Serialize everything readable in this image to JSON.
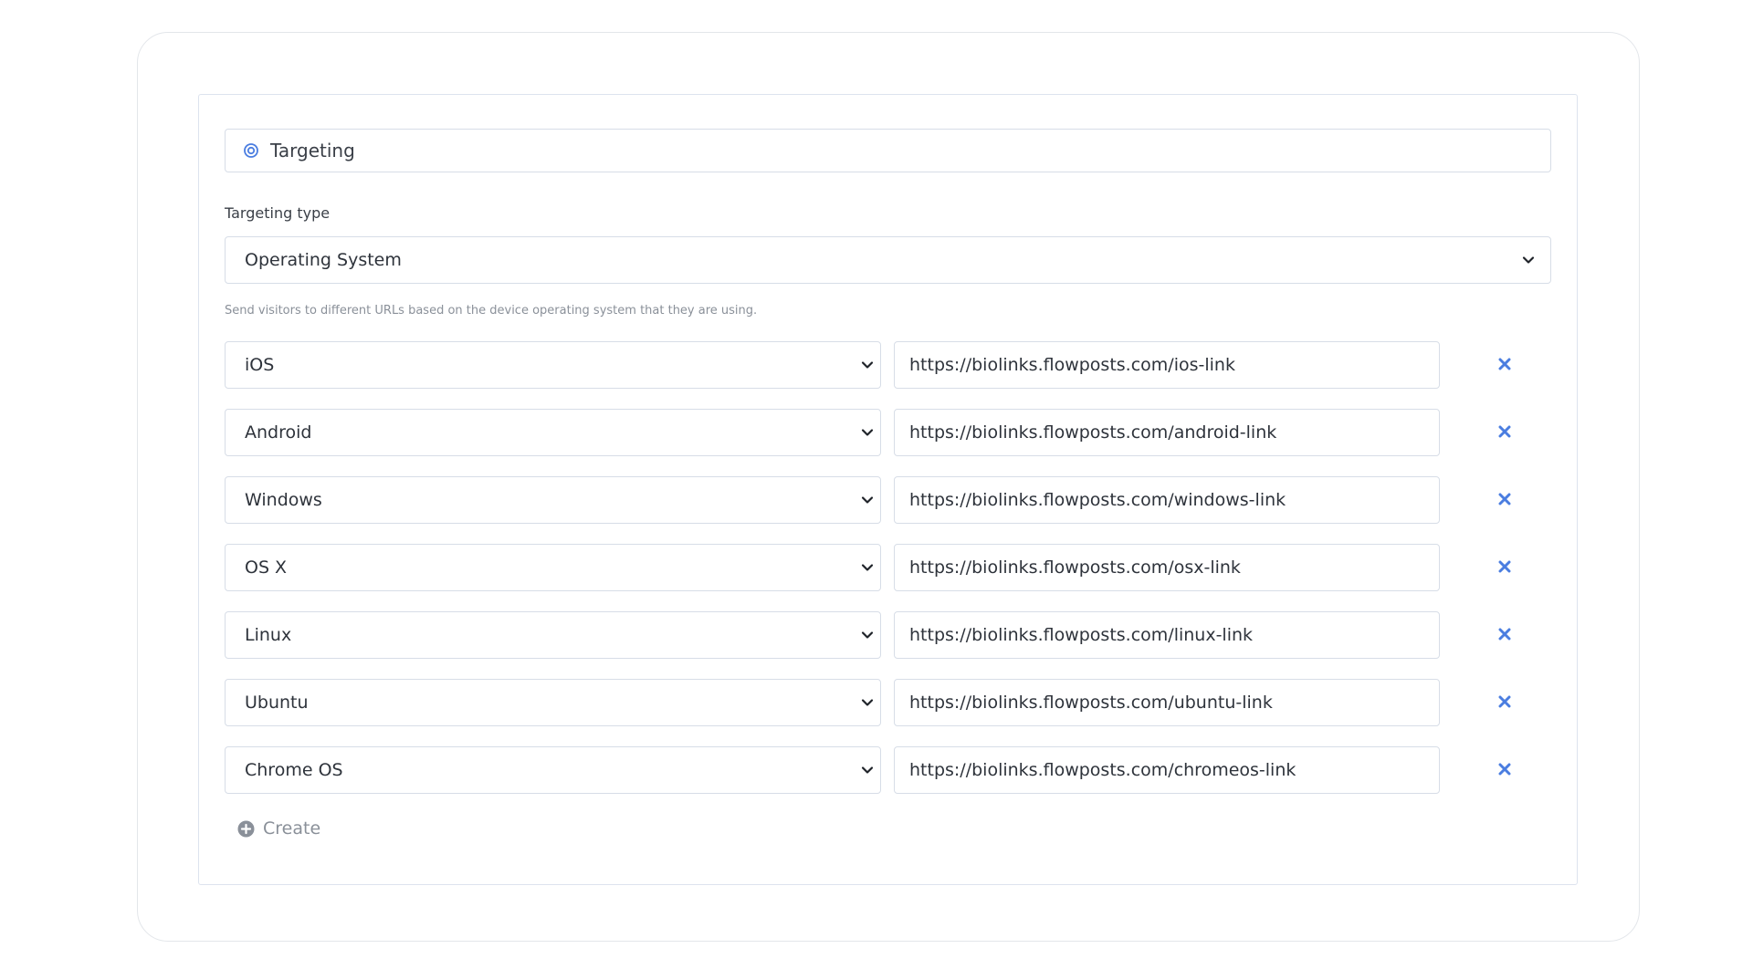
{
  "section": {
    "header_title": "Targeting",
    "header_icon": "target-icon"
  },
  "targeting_type": {
    "label": "Targeting type",
    "selected": "Operating System",
    "help_text": "Send visitors to different URLs based on the device operating system that they are using."
  },
  "rules": [
    {
      "os": "iOS",
      "url": "https://biolinks.flowposts.com/ios-link"
    },
    {
      "os": "Android",
      "url": "https://biolinks.flowposts.com/android-link"
    },
    {
      "os": "Windows",
      "url": "https://biolinks.flowposts.com/windows-link"
    },
    {
      "os": "OS X",
      "url": "https://biolinks.flowposts.com/osx-link"
    },
    {
      "os": "Linux",
      "url": "https://biolinks.flowposts.com/linux-link"
    },
    {
      "os": "Ubuntu",
      "url": "https://biolinks.flowposts.com/ubuntu-link"
    },
    {
      "os": "Chrome OS",
      "url": "https://biolinks.flowposts.com/chromeos-link"
    }
  ],
  "create_label": "Create",
  "colors": {
    "accent": "#4a7de0",
    "muted": "#8a9099",
    "border": "#d7dde7"
  }
}
